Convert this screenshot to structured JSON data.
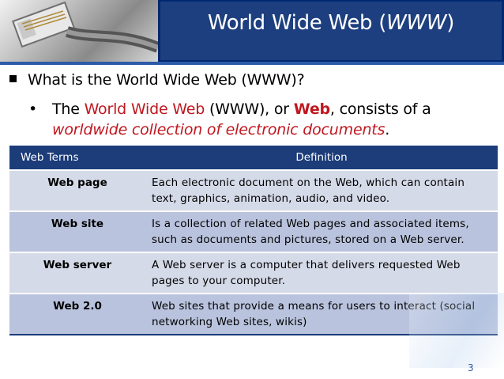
{
  "slide": {
    "title_main": "World Wide Web (",
    "title_italic": "WWW",
    "title_end": ")",
    "page_number": "3"
  },
  "bullets": {
    "question": "What is the World Wide Web (WWW)?",
    "dot": "•",
    "answer_1": "The ",
    "answer_red_1": "World Wide Web",
    "answer_2": " (WWW), or ",
    "answer_red_bold": "Web",
    "answer_3": ", consists of a ",
    "answer_red_italic": "worldwide collection of electronic documents",
    "answer_4": "."
  },
  "table": {
    "headers": [
      "Web Terms",
      "Definition"
    ],
    "rows": [
      {
        "term": "Web page",
        "definition": "Each electronic document on the Web, which can contain text, graphics, animation, audio, and video."
      },
      {
        "term": "Web site",
        "definition": "Is a collection of related Web pages and associated items, such as documents and pictures, stored on a Web server."
      },
      {
        "term": "Web server",
        "definition": "A Web server is a computer that delivers requested Web pages to your computer."
      },
      {
        "term": "Web 2.0",
        "definition": "Web sites that provide a means for users to interact (social networking Web sites, wikis)"
      }
    ]
  },
  "colors": {
    "header_navy": "#002870",
    "accent_red": "#c0171f",
    "table_header": "#1c3c7a",
    "row_light": "#d5dae8",
    "row_dark": "#b9c3dd"
  }
}
